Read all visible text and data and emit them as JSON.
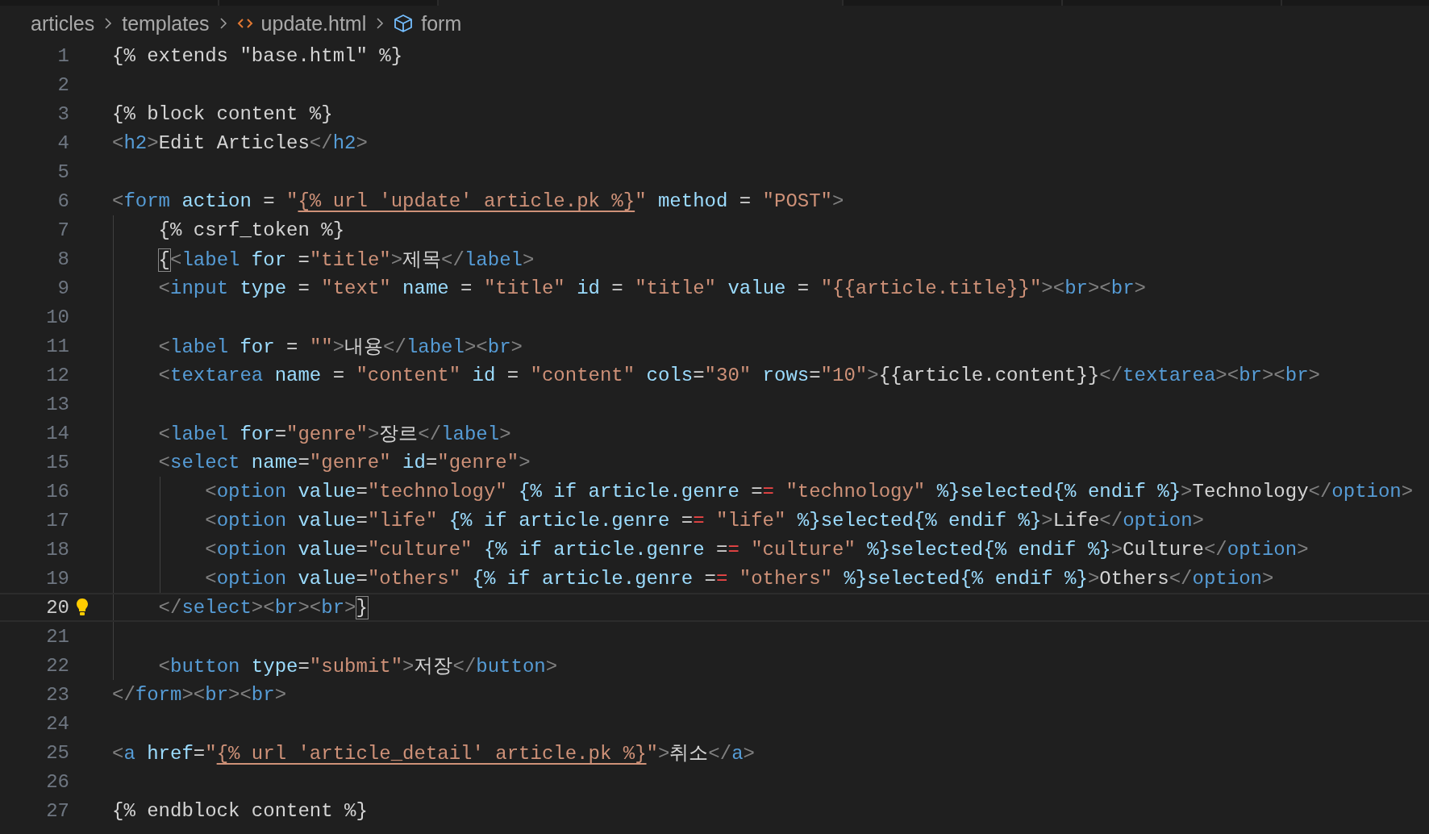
{
  "breadcrumbs": [
    {
      "label": "articles"
    },
    {
      "label": "templates"
    },
    {
      "label": "update.html"
    },
    {
      "label": "form"
    }
  ],
  "lines": [
    {
      "number": "1",
      "current": false,
      "lightbulb": false,
      "bracket_match": false,
      "text": "{% extends \"base.html\" %}"
    },
    {
      "number": "2",
      "current": false,
      "lightbulb": false
    },
    {
      "number": "3",
      "current": false,
      "lightbulb": false,
      "bracket_match": false,
      "text": "{% block content %}"
    },
    {
      "number": "4",
      "current": false,
      "lightbulb": false,
      "bracket_match": false,
      "text": "<h2>Edit Articles</h2>"
    },
    {
      "number": "5",
      "current": false,
      "lightbulb": false
    },
    {
      "number": "6",
      "current": false,
      "lightbulb": false,
      "bracket_match": false,
      "text": "<form action = \"{% url 'update' article.pk %}\" method = \"POST\">"
    },
    {
      "number": "7",
      "current": false,
      "lightbulb": false,
      "bracket_match": false,
      "text": "    {% csrf_token %}"
    },
    {
      "number": "8",
      "current": false,
      "lightbulb": false,
      "bracket_match": true,
      "text": "    {<label for =\"title\">제목</label>"
    },
    {
      "number": "9",
      "current": false,
      "lightbulb": false,
      "bracket_match": false,
      "text": "    <input type = \"text\" name = \"title\" id = \"title\" value = \"{{article.title}}\"><br><br>"
    },
    {
      "number": "10",
      "current": false,
      "lightbulb": false
    },
    {
      "number": "11",
      "current": false,
      "lightbulb": false,
      "bracket_match": false,
      "text": "    <label for = \"\">내용</label><br>"
    },
    {
      "number": "12",
      "current": false,
      "lightbulb": false,
      "bracket_match": false,
      "text": "    <textarea name = \"content\" id = \"content\" cols=\"30\" rows=\"10\">{{article.content}}</textarea><br><br>"
    },
    {
      "number": "13",
      "current": false,
      "lightbulb": false
    },
    {
      "number": "14",
      "current": false,
      "lightbulb": false,
      "bracket_match": false,
      "text": "    <label for=\"genre\">장르</label>"
    },
    {
      "number": "15",
      "current": false,
      "lightbulb": false,
      "bracket_match": false,
      "text": "    <select name=\"genre\" id=\"genre\">"
    },
    {
      "number": "16",
      "current": false,
      "lightbulb": false,
      "bracket_match": false,
      "text": "        <option value=\"technology\" {% if article.genre == \"technology\" %}selected{% endif %}>Technology</option>"
    },
    {
      "number": "17",
      "current": false,
      "lightbulb": false,
      "bracket_match": false,
      "text": "        <option value=\"life\" {% if article.genre == \"life\" %}selected{% endif %}>Life</option>"
    },
    {
      "number": "18",
      "current": false,
      "lightbulb": false,
      "bracket_match": false,
      "text": "        <option value=\"culture\" {% if article.genre == \"culture\" %}selected{% endif %}>Culture</option>"
    },
    {
      "number": "19",
      "current": false,
      "lightbulb": false,
      "bracket_match": false,
      "text": "        <option value=\"others\" {% if article.genre == \"others\" %}selected{% endif %}>Others</option>"
    },
    {
      "number": "20",
      "current": true,
      "lightbulb": true,
      "bracket_match": true,
      "text": "    </select><br><br>}"
    },
    {
      "number": "21",
      "current": false,
      "lightbulb": false
    },
    {
      "number": "22",
      "current": false,
      "lightbulb": false,
      "bracket_match": false,
      "text": "    <button type=\"submit\">저장</button>"
    },
    {
      "number": "23",
      "current": false,
      "lightbulb": false,
      "bracket_match": false,
      "text": "</form><br><br>"
    },
    {
      "number": "24",
      "current": false,
      "lightbulb": false
    },
    {
      "number": "25",
      "current": false,
      "lightbulb": false,
      "bracket_match": false,
      "text": "<a href=\"{% url 'article_detail' article.pk %}\">취소</a>"
    },
    {
      "number": "26",
      "current": false,
      "lightbulb": false
    },
    {
      "number": "27",
      "current": false,
      "lightbulb": false,
      "bracket_match": false,
      "text": "{% endblock content %}"
    }
  ]
}
